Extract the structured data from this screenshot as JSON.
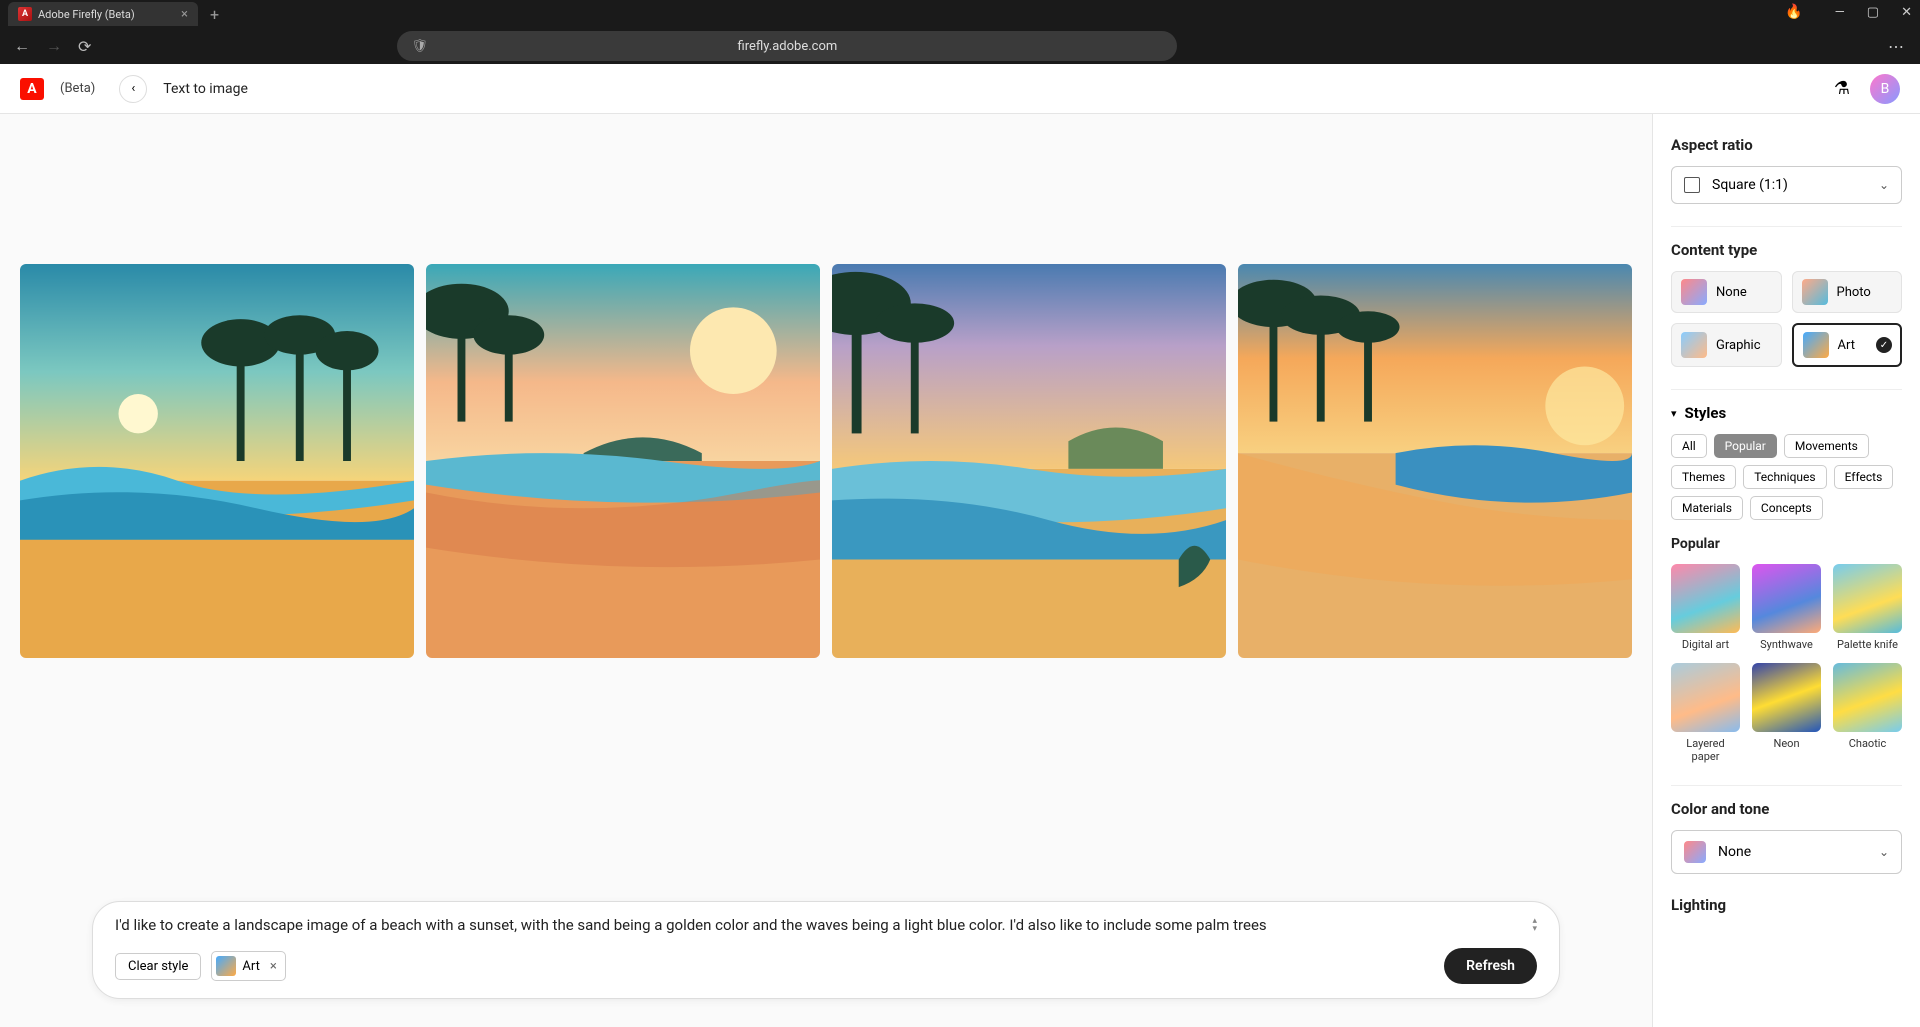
{
  "browser": {
    "tab_title": "Adobe Firefly (Beta)",
    "url": "firefly.adobe.com"
  },
  "header": {
    "beta_label": "(Beta)",
    "page_title": "Text to image"
  },
  "prompt": {
    "text": "I'd like to create a landscape image of a beach with a sunset, with the sand being a golden color and the waves being a light blue color. I'd also like to include some palm trees",
    "clear_style_label": "Clear style",
    "style_chip_label": "Art",
    "refresh_label": "Refresh"
  },
  "sidebar": {
    "aspect_ratio": {
      "title": "Aspect ratio",
      "value": "Square (1:1)"
    },
    "content_type": {
      "title": "Content type",
      "options": [
        {
          "label": "None",
          "selected": false
        },
        {
          "label": "Photo",
          "selected": false
        },
        {
          "label": "Graphic",
          "selected": false
        },
        {
          "label": "Art",
          "selected": true
        }
      ]
    },
    "styles": {
      "title": "Styles",
      "tabs": [
        "All",
        "Popular",
        "Movements",
        "Themes",
        "Techniques",
        "Effects",
        "Materials",
        "Concepts"
      ],
      "active_tab": "Popular",
      "popular_title": "Popular",
      "popular": [
        "Digital art",
        "Synthwave",
        "Palette knife",
        "Layered paper",
        "Neon",
        "Chaotic"
      ]
    },
    "color_tone": {
      "title": "Color and tone",
      "value": "None"
    },
    "lighting": {
      "title": "Lighting"
    }
  }
}
